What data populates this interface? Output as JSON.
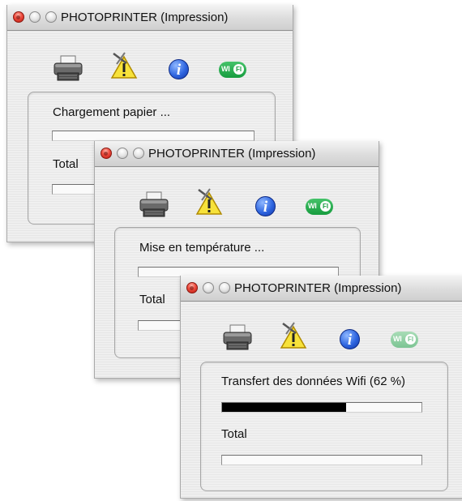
{
  "windows": [
    {
      "title": "PHOTOPRINTER (Impression)",
      "status_label": "Chargement papier ...",
      "status_progress": 0,
      "total_label": "Total",
      "total_progress": 0,
      "icons": [
        "printer-icon",
        "warning-icon",
        "info-icon",
        "wifi-icon"
      ]
    },
    {
      "title": "PHOTOPRINTER (Impression)",
      "status_label": "Mise en température ...",
      "status_progress": 0,
      "total_label": "Total",
      "total_progress": 0,
      "icons": [
        "printer-icon",
        "warning-icon",
        "info-icon",
        "wifi-icon"
      ]
    },
    {
      "title": "PHOTOPRINTER (Impression)",
      "status_label": "Transfert des données Wifi (62 %)",
      "status_progress": 0.62,
      "total_label": "Total",
      "total_progress": 0,
      "icons": [
        "printer-icon",
        "warning-icon",
        "info-icon",
        "wifi-icon"
      ]
    }
  ],
  "icons": {
    "info_glyph": "i",
    "wifi_text": "WI",
    "wifi_fi": "FI"
  },
  "colors": {
    "close_button": "#ee4a3c",
    "progress_fill": "#000000",
    "info_blue": "#2f66e0",
    "wifi_green": "#169c3e"
  }
}
